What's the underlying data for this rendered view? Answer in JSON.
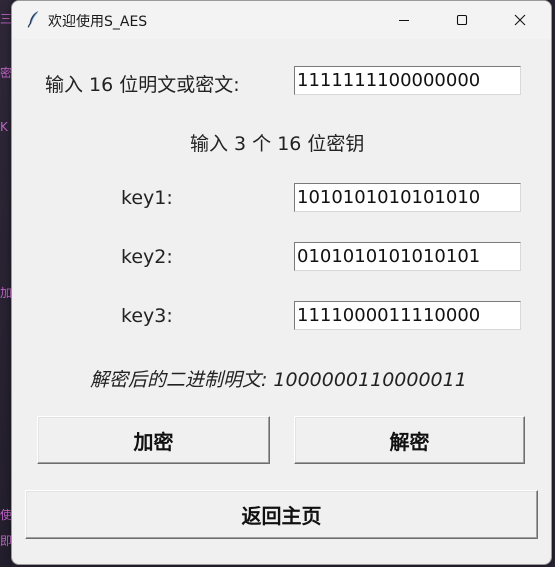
{
  "window": {
    "title": "欢迎使用S_AES"
  },
  "form": {
    "input_label": "输入 16 位明文或密文:",
    "input_value": "1111111100000000",
    "keys_heading": "输入 3 个 16 位密钥",
    "keys": [
      {
        "label": "key1:",
        "value": "1010101010101010"
      },
      {
        "label": "key2:",
        "value": "0101010101010101"
      },
      {
        "label": "key3:",
        "value": "1111000011110000"
      }
    ],
    "result_label": "解密后的二进制明文:",
    "result_value": "1000000110000011"
  },
  "buttons": {
    "encrypt": "加密",
    "decrypt": "解密",
    "back": "返回主页"
  },
  "icons": {
    "app": "feather-icon",
    "minimize": "minimize-icon",
    "maximize": "maximize-icon",
    "close": "close-icon"
  }
}
